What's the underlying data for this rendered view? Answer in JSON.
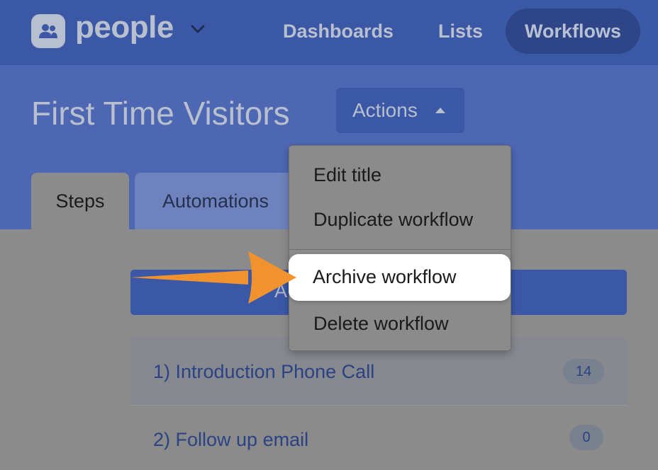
{
  "app": {
    "name": "people",
    "brand_color": "#3b58a6"
  },
  "nav": {
    "items": [
      {
        "label": "Dashboards"
      },
      {
        "label": "Lists"
      },
      {
        "label": "Workflows",
        "active": true
      }
    ]
  },
  "page": {
    "title": "First Time Visitors",
    "actions_label": "Actions"
  },
  "tabs": [
    {
      "label": "Steps",
      "active": true
    },
    {
      "label": "Automations"
    }
  ],
  "main": {
    "add_button_label": "A"
  },
  "steps": [
    {
      "label": "1) Introduction Phone Call",
      "count": "14"
    },
    {
      "label": "2) Follow up email",
      "count": "0"
    }
  ],
  "dropdown": {
    "items": [
      {
        "label": "Edit title"
      },
      {
        "label": "Duplicate workflow"
      },
      {
        "label": "Archive workflow",
        "highlighted": true
      },
      {
        "label": "Delete workflow"
      }
    ]
  },
  "annotation": {
    "arrow_color": "#f0922e",
    "icon": "arrow-right-icon"
  }
}
